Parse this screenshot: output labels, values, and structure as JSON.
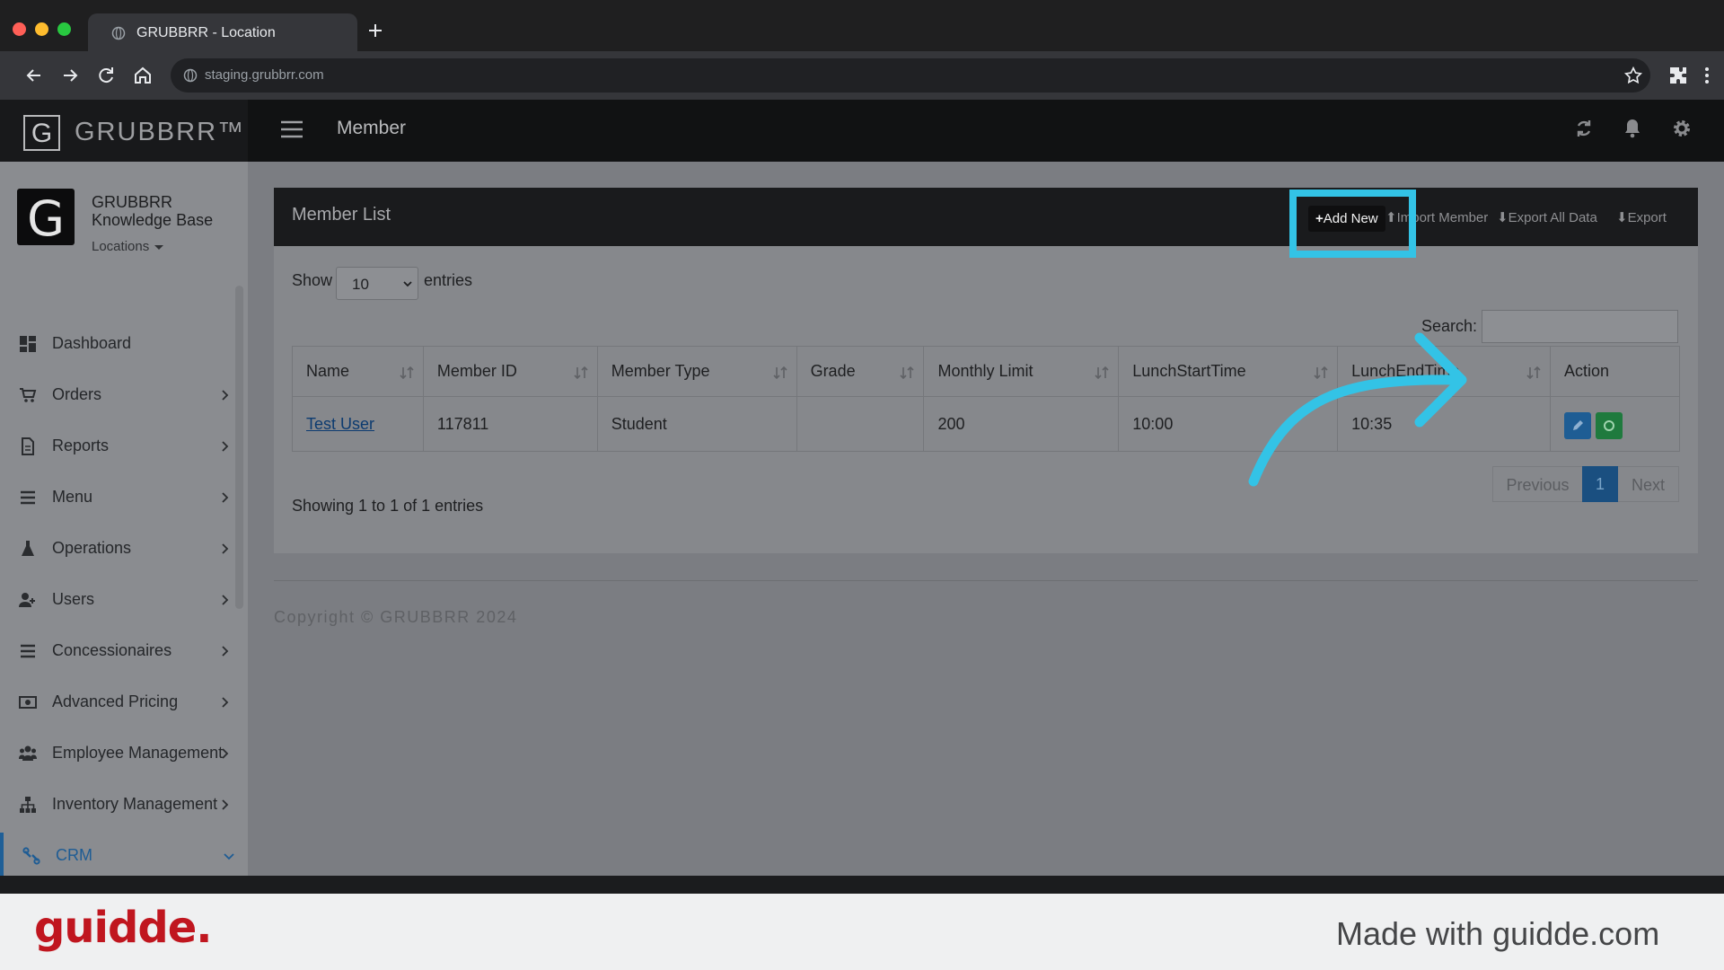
{
  "browser": {
    "tab_title": "GRUBBRR - Location",
    "url": "staging.grubbrr.com"
  },
  "app": {
    "brand": "GRUBBRR™",
    "brand_letter": "G",
    "page_title": "Member"
  },
  "sidebar": {
    "logo_letter": "G",
    "org_name_line1": "GRUBBRR",
    "org_name_line2": "Knowledge Base",
    "locations_label": "Locations",
    "items": [
      {
        "label": "Dashboard",
        "icon": "dashboard-icon",
        "has_chevron": false
      },
      {
        "label": "Orders",
        "icon": "cart-icon",
        "has_chevron": true
      },
      {
        "label": "Reports",
        "icon": "report-icon",
        "has_chevron": true
      },
      {
        "label": "Menu",
        "icon": "list-icon",
        "has_chevron": true
      },
      {
        "label": "Operations",
        "icon": "flask-icon",
        "has_chevron": true
      },
      {
        "label": "Users",
        "icon": "users-icon",
        "has_chevron": true
      },
      {
        "label": "Concessionaires",
        "icon": "list-icon",
        "has_chevron": true
      },
      {
        "label": "Advanced Pricing",
        "icon": "money-icon",
        "has_chevron": true
      },
      {
        "label": "Employee Management",
        "icon": "group-icon",
        "has_chevron": true
      },
      {
        "label": "Inventory Management",
        "icon": "sitemap-icon",
        "has_chevron": true
      },
      {
        "label": "CRM",
        "icon": "crm-icon",
        "has_chevron": true,
        "active": true
      }
    ]
  },
  "panel": {
    "title": "Member List",
    "add_new": "Add New",
    "import_member": "Import Member",
    "export_all": "Export All Data",
    "export": "Export"
  },
  "table_controls": {
    "show_label": "Show",
    "page_length": "10",
    "entries_label": "entries",
    "search_label": "Search:",
    "search_value": ""
  },
  "table": {
    "columns": [
      "Name",
      "Member ID",
      "Member Type",
      "Grade",
      "Monthly Limit",
      "LunchStartTime",
      "LunchEndTime",
      "Action"
    ],
    "rows": [
      {
        "name": "Test User",
        "member_id": "117811",
        "member_type": "Student",
        "grade": "",
        "monthly_limit": "200",
        "lunch_start": "10:00",
        "lunch_end": "10:35"
      }
    ]
  },
  "footer_info": {
    "showing": "Showing 1 to 1 of 1 entries",
    "previous": "Previous",
    "current_page": "1",
    "next": "Next",
    "copyright": "Copyright © GRUBBRR 2024"
  },
  "guidde": {
    "logo": "guidde.",
    "made_with": "Made with guidde.com"
  },
  "colors": {
    "highlight": "#33c3e6",
    "active_nav": "#1e5c94",
    "guidde_red": "#c0161f"
  }
}
